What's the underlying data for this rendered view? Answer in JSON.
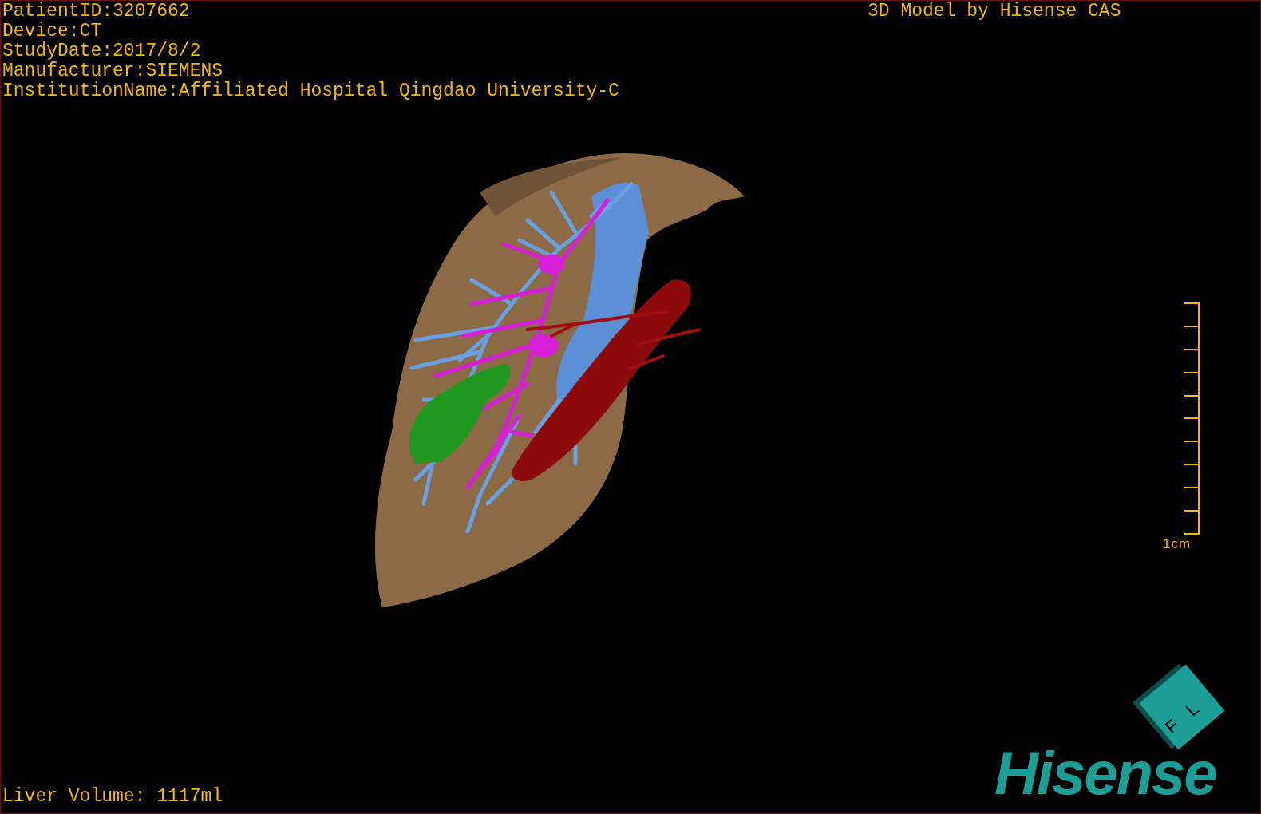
{
  "viewport": {
    "info_lines": [
      "PatientID:3207662",
      "Device:CT",
      "StudyDate:2017/8/2",
      "Manufacturer:SIEMENS",
      "InstitutionName:Affiliated Hospital Qingdao University-C"
    ],
    "title": "3D Model by Hisense CAS",
    "scale_bar": {
      "label": "1cm"
    },
    "orientation_cube": {
      "labels": [
        "F",
        "L"
      ]
    },
    "logo": "Hisense",
    "liver_volume": "Liver Volume: 1117ml"
  }
}
